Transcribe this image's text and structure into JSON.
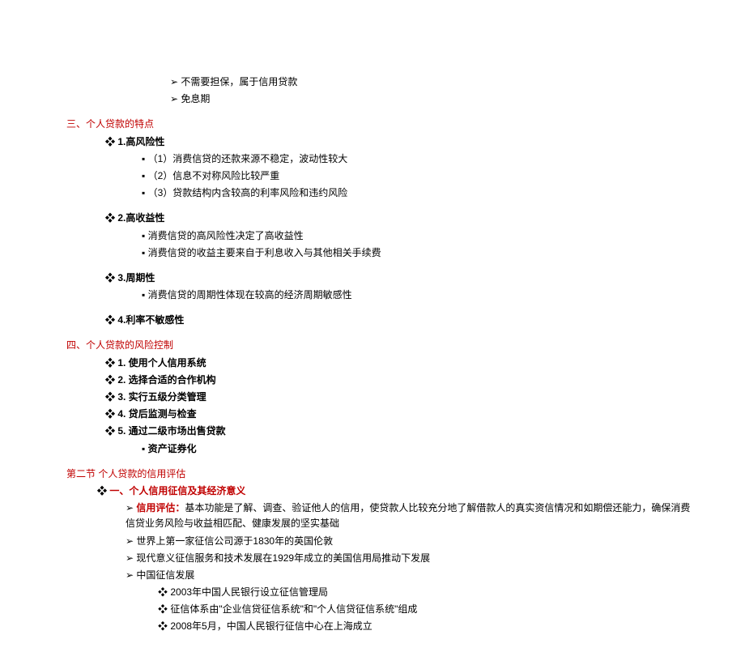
{
  "topSub": {
    "a": "不需要担保，属于信用贷款",
    "b": "免息期"
  },
  "sec3": {
    "title": "三、个人贷款的特点",
    "p1": {
      "head": "1.高风险性",
      "a": "（1）消费信贷的还款来源不稳定，波动性较大",
      "b": "（2）信息不对称风险比较严重",
      "c": "（3）贷款结构内含较高的利率风险和违约风险"
    },
    "p2": {
      "head": "2.高收益性",
      "a": "消费信贷的高风险性决定了高收益性",
      "b": "消费信贷的收益主要来自于利息收入与其他相关手续费"
    },
    "p3": {
      "head": "3.周期性",
      "a": "消费信贷的周期性体现在较高的经济周期敏感性"
    },
    "p4": {
      "head": "4.利率不敏感性"
    }
  },
  "sec4": {
    "title": "四、个人贷款的风险控制",
    "a": "1. 使用个人信用系统",
    "b": "2. 选择合适的合作机构",
    "c": "3. 实行五级分类管理",
    "d": "4. 贷后监测与检查",
    "e": "5. 通过二级市场出售贷款",
    "e1": "资产证券化"
  },
  "sec5": {
    "title": "第二节  个人贷款的信用评估",
    "sub": "一、个人信用征信及其经济意义",
    "p1label": "信用评估：",
    "p1text": "基本功能是了解、调查、验证他人的信用，使贷款人比较充分地了解借款人的真实资信情况和如期偿还能力，确保消费信贷业务风险与收益相匹配、健康发展的坚实基础",
    "p2": "世界上第一家征信公司源于1830年的英国伦敦",
    "p3": "现代意义征信服务和技术发展在1929年成立的美国信用局推动下发展",
    "p4": "中国征信发展",
    "p4a": "2003年中国人民银行设立征信管理局",
    "p4b": "征信体系由\"企业信贷征信系统\"和\"个人信贷征信系统\"组成",
    "p4c": "2008年5月，中国人民银行征信中心在上海成立"
  }
}
